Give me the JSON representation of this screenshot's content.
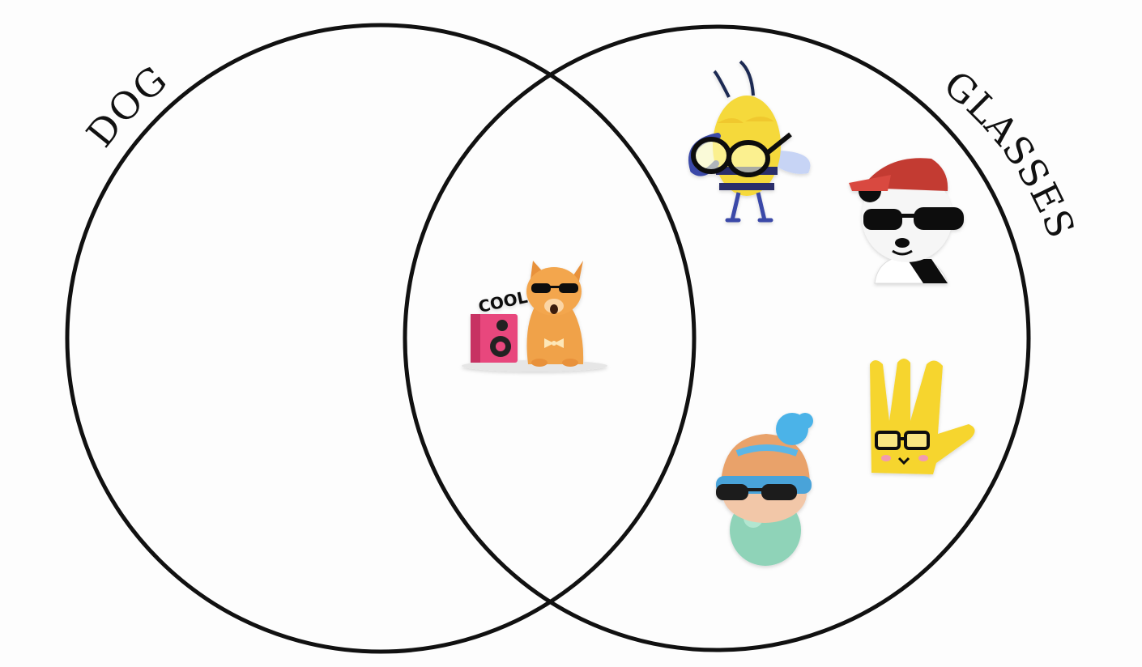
{
  "diagram": {
    "type": "venn",
    "sets": [
      {
        "label": "DOG"
      },
      {
        "label": "GLASSES"
      }
    ],
    "regions": {
      "dog_only": [],
      "both": [
        {
          "icon": "cool-dog-with-speaker-sticker",
          "text": "COOL"
        }
      ],
      "glasses_only": [
        {
          "icon": "bee-with-glasses-sticker"
        },
        {
          "icon": "panda-with-cap-and-sunglasses-sticker"
        },
        {
          "icon": "yellow-hand-with-glasses-sticker"
        },
        {
          "icon": "bubblegum-character-with-beanie-and-sunglasses-sticker"
        }
      ]
    },
    "colors": {
      "outline": "#111111",
      "background": "#fdfdfd"
    }
  }
}
